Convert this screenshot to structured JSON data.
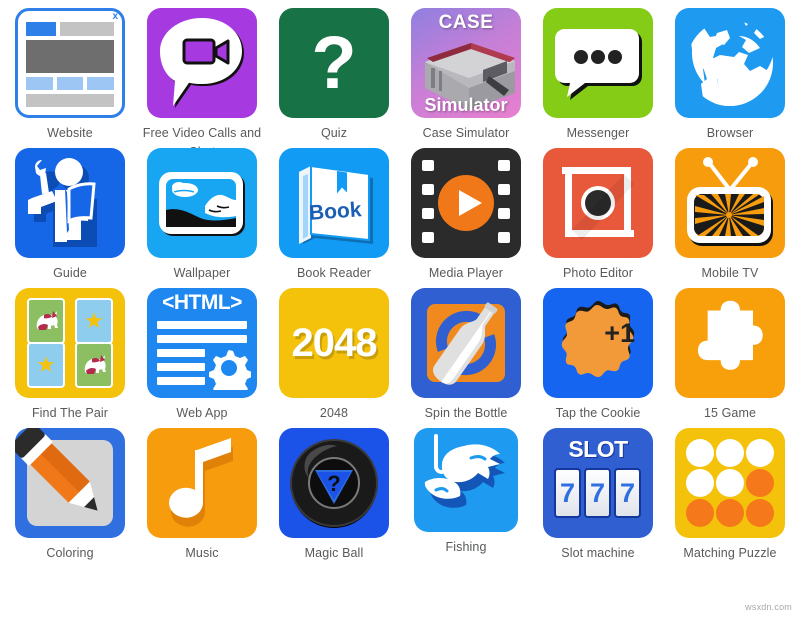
{
  "page": {
    "watermark": "wsxdn.com",
    "columns": 6,
    "rows": 4,
    "background": "#ffffff",
    "label_color": "#58595b"
  },
  "apps": [
    {
      "id": "website",
      "label": "Website",
      "icon": "browser-window-icon",
      "tile_color": "#ffffff"
    },
    {
      "id": "video-calls",
      "label": "Free Video Calls and Chat",
      "icon": "video-chat-bubble-icon",
      "tile_color": "#a63ae0"
    },
    {
      "id": "quiz",
      "label": "Quiz",
      "icon": "question-mark-icon",
      "tile_color": "#177245",
      "glyph": "?"
    },
    {
      "id": "case-simulator",
      "label": "Case Simulator",
      "icon": "weapon-case-icon",
      "tile_color": "#c77fd6",
      "text_top": "CASE",
      "text_bottom": "Simulator"
    },
    {
      "id": "messenger",
      "label": "Messenger",
      "icon": "speech-bubble-icon",
      "tile_color": "#84cc16"
    },
    {
      "id": "browser",
      "label": "Browser",
      "icon": "globe-icon",
      "tile_color": "#1e9bf0"
    },
    {
      "id": "guide",
      "label": "Guide",
      "icon": "person-with-wrench-icon",
      "tile_color": "#1667e8"
    },
    {
      "id": "wallpaper",
      "label": "Wallpaper",
      "icon": "landscape-photo-icon",
      "tile_color": "#18a5f2"
    },
    {
      "id": "book-reader",
      "label": "Book Reader",
      "icon": "book-icon",
      "tile_color": "#129bf5",
      "glyph": "Book"
    },
    {
      "id": "media-player",
      "label": "Media Player",
      "icon": "film-play-icon",
      "tile_color": "#2b2b2b"
    },
    {
      "id": "photo-editor",
      "label": "Photo Editor",
      "icon": "camera-crop-icon",
      "tile_color": "#e8593c"
    },
    {
      "id": "mobile-tv",
      "label": "Mobile TV",
      "icon": "television-icon",
      "tile_color": "#f79c0c"
    },
    {
      "id": "find-the-pair",
      "label": "Find The Pair",
      "icon": "memory-cards-icon",
      "tile_color": "#f5c20b"
    },
    {
      "id": "web-app",
      "label": "Web App",
      "icon": "html-gear-icon",
      "tile_color": "#1e88f0",
      "glyph": "<HTML>"
    },
    {
      "id": "2048",
      "label": "2048",
      "icon": "number-2048-icon",
      "tile_color": "#f5c20b",
      "glyph": "2048"
    },
    {
      "id": "spin-the-bottle",
      "label": "Spin the Bottle",
      "icon": "bottle-spin-icon",
      "tile_color": "#2f5fd0"
    },
    {
      "id": "tap-the-cookie",
      "label": "Tap the Cookie",
      "icon": "cookie-icon",
      "tile_color": "#1565f0",
      "glyph": "+1"
    },
    {
      "id": "15-game",
      "label": "15 Game",
      "icon": "puzzle-piece-icon",
      "tile_color": "#f7a00c"
    },
    {
      "id": "coloring",
      "label": "Coloring",
      "icon": "pencil-icon",
      "tile_color": "#2f6fe0"
    },
    {
      "id": "music",
      "label": "Music",
      "icon": "music-note-icon",
      "tile_color": "#f79c0c"
    },
    {
      "id": "magic-ball",
      "label": "Magic Ball",
      "icon": "magic-8-ball-icon",
      "tile_color": "#1b52e8",
      "glyph": "?"
    },
    {
      "id": "fishing",
      "label": "Fishing",
      "icon": "fish-hook-icon",
      "tile_color": "#1e9bf0"
    },
    {
      "id": "slot-machine",
      "label": "Slot machine",
      "icon": "slot-reels-icon",
      "tile_color": "#2f5fd0",
      "text_top": "SLOT",
      "reels": [
        "7",
        "7",
        "7"
      ]
    },
    {
      "id": "matching-puzzle",
      "label": "Matching Puzzle",
      "icon": "colored-dots-grid-icon",
      "tile_color": "#f5c20b"
    }
  ]
}
